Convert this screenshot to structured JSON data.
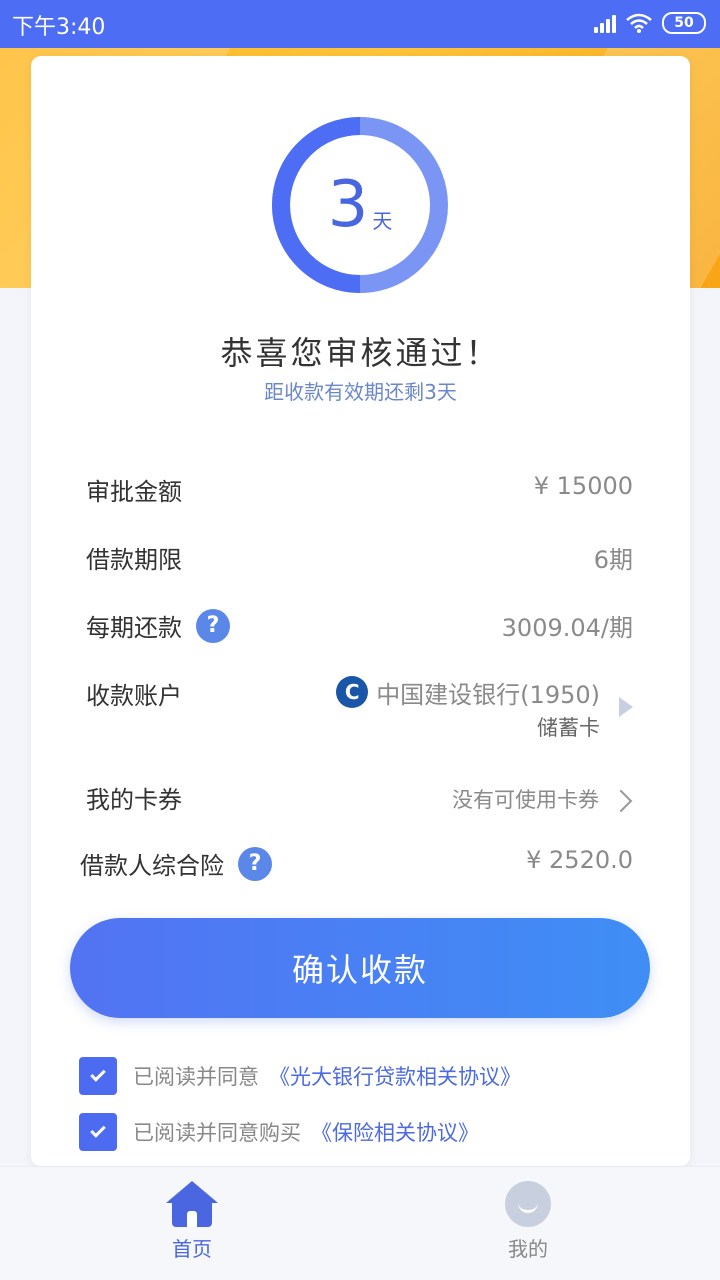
{
  "status_bar": {
    "time": "下午3:40",
    "battery": "50"
  },
  "countdown": {
    "number": "3",
    "unit": "天",
    "progress": 0.5
  },
  "title": "恭喜您审核通过！",
  "subtitle": "距收款有效期还剩3天",
  "details": {
    "approved_amount": {
      "label": "审批金额",
      "value": "¥ 15000"
    },
    "loan_term": {
      "label": "借款期限",
      "value": "6期"
    },
    "installment": {
      "label": "每期还款",
      "value": "3009.04/期",
      "help": "?"
    },
    "account": {
      "label": "收款账户",
      "bank": "中国建设银行(1950)",
      "card_type": "储蓄卡"
    },
    "coupons": {
      "label": "我的卡券",
      "value": "没有可使用卡券"
    },
    "insurance": {
      "label": "借款人综合险",
      "value": "¥ 2520.0",
      "help": "?"
    }
  },
  "confirm_button": "确认收款",
  "agreements": [
    {
      "text": "已阅读并同意",
      "link": "《光大银行贷款相关协议》",
      "checked": true
    },
    {
      "text": "已阅读并同意购买",
      "link": "《保险相关协议》",
      "checked": true
    }
  ],
  "tabs": [
    {
      "label": "首页",
      "icon": "home-icon",
      "active": true
    },
    {
      "label": "我的",
      "icon": "profile-icon",
      "active": false
    }
  ],
  "colors": {
    "accent": "#4d6df5",
    "banner": "#ffb823",
    "ring": "#7b95f4"
  }
}
